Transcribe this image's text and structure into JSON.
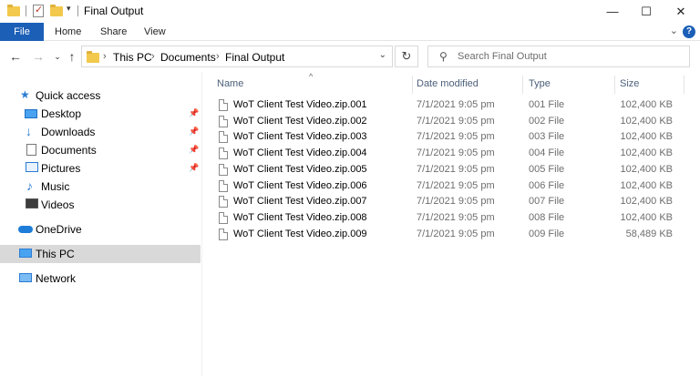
{
  "window": {
    "title": "Final Output",
    "controls": {
      "minimize": "—",
      "maximize": "☐",
      "close": "✕"
    }
  },
  "ribbon": {
    "tabs": [
      "File",
      "Home",
      "Share",
      "View"
    ],
    "accent": "#1b5fb7"
  },
  "address": {
    "crumbs": [
      "This PC",
      "Documents",
      "Final Output"
    ],
    "search_placeholder": "Search Final Output"
  },
  "nav_pane": {
    "items": [
      {
        "label": "Quick access",
        "icon": "star-icon"
      },
      {
        "label": "Desktop",
        "icon": "desktop-icon",
        "pinned": true
      },
      {
        "label": "Downloads",
        "icon": "download-icon",
        "pinned": true
      },
      {
        "label": "Documents",
        "icon": "documents-icon",
        "pinned": true
      },
      {
        "label": "Pictures",
        "icon": "pictures-icon",
        "pinned": true
      },
      {
        "label": "Music",
        "icon": "music-icon"
      },
      {
        "label": "Videos",
        "icon": "videos-icon"
      },
      {
        "label": "OneDrive",
        "icon": "onedrive-icon"
      },
      {
        "label": "This PC",
        "icon": "pc-icon",
        "selected": true
      },
      {
        "label": "Network",
        "icon": "network-icon"
      }
    ]
  },
  "file_list": {
    "columns": [
      "Name",
      "Date modified",
      "Type",
      "Size"
    ],
    "rows": [
      {
        "name": "WoT Client Test Video.zip.001",
        "date": "7/1/2021 9:05 pm",
        "type": "001 File",
        "size": "102,400 KB"
      },
      {
        "name": "WoT Client Test Video.zip.002",
        "date": "7/1/2021 9:05 pm",
        "type": "002 File",
        "size": "102,400 KB"
      },
      {
        "name": "WoT Client Test Video.zip.003",
        "date": "7/1/2021 9:05 pm",
        "type": "003 File",
        "size": "102,400 KB"
      },
      {
        "name": "WoT Client Test Video.zip.004",
        "date": "7/1/2021 9:05 pm",
        "type": "004 File",
        "size": "102,400 KB"
      },
      {
        "name": "WoT Client Test Video.zip.005",
        "date": "7/1/2021 9:05 pm",
        "type": "005 File",
        "size": "102,400 KB"
      },
      {
        "name": "WoT Client Test Video.zip.006",
        "date": "7/1/2021 9:05 pm",
        "type": "006 File",
        "size": "102,400 KB"
      },
      {
        "name": "WoT Client Test Video.zip.007",
        "date": "7/1/2021 9:05 pm",
        "type": "007 File",
        "size": "102,400 KB"
      },
      {
        "name": "WoT Client Test Video.zip.008",
        "date": "7/1/2021 9:05 pm",
        "type": "008 File",
        "size": "102,400 KB"
      },
      {
        "name": "WoT Client Test Video.zip.009",
        "date": "7/1/2021 9:05 pm",
        "type": "009 File",
        "size": "58,489 KB"
      }
    ]
  }
}
